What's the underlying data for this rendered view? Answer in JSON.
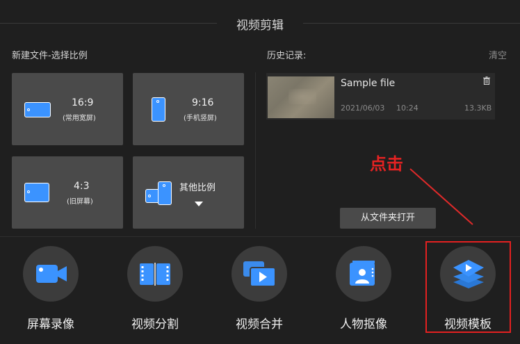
{
  "header": {
    "title": "视频剪辑"
  },
  "new_file": {
    "label": "新建文件-选择比例",
    "cards": [
      {
        "ratio": "16:9",
        "desc": "(常用宽屏)"
      },
      {
        "ratio": "9:16",
        "desc": "(手机竖屏)"
      },
      {
        "ratio": "4:3",
        "desc": "(旧屏幕)"
      },
      {
        "ratio": "其他比例",
        "desc": ""
      }
    ]
  },
  "history": {
    "label": "历史记录:",
    "clear": "清空",
    "items": [
      {
        "name": "Sample file",
        "date": "2021/06/03",
        "time": "10:24",
        "size": "13.3KB"
      }
    ]
  },
  "open_folder": "从文件夹打开",
  "annotation": "点击",
  "tools": [
    {
      "label": "屏幕录像",
      "icon": "camera-icon"
    },
    {
      "label": "视频分割",
      "icon": "film-split-icon"
    },
    {
      "label": "视频合并",
      "icon": "video-merge-icon"
    },
    {
      "label": "人物抠像",
      "icon": "person-cutout-icon"
    },
    {
      "label": "视频模板",
      "icon": "layers-play-icon"
    }
  ],
  "colors": {
    "accent": "#3b93ff",
    "annotation": "#e52222",
    "background": "#1f1f1f",
    "card": "#4a4a4a"
  }
}
